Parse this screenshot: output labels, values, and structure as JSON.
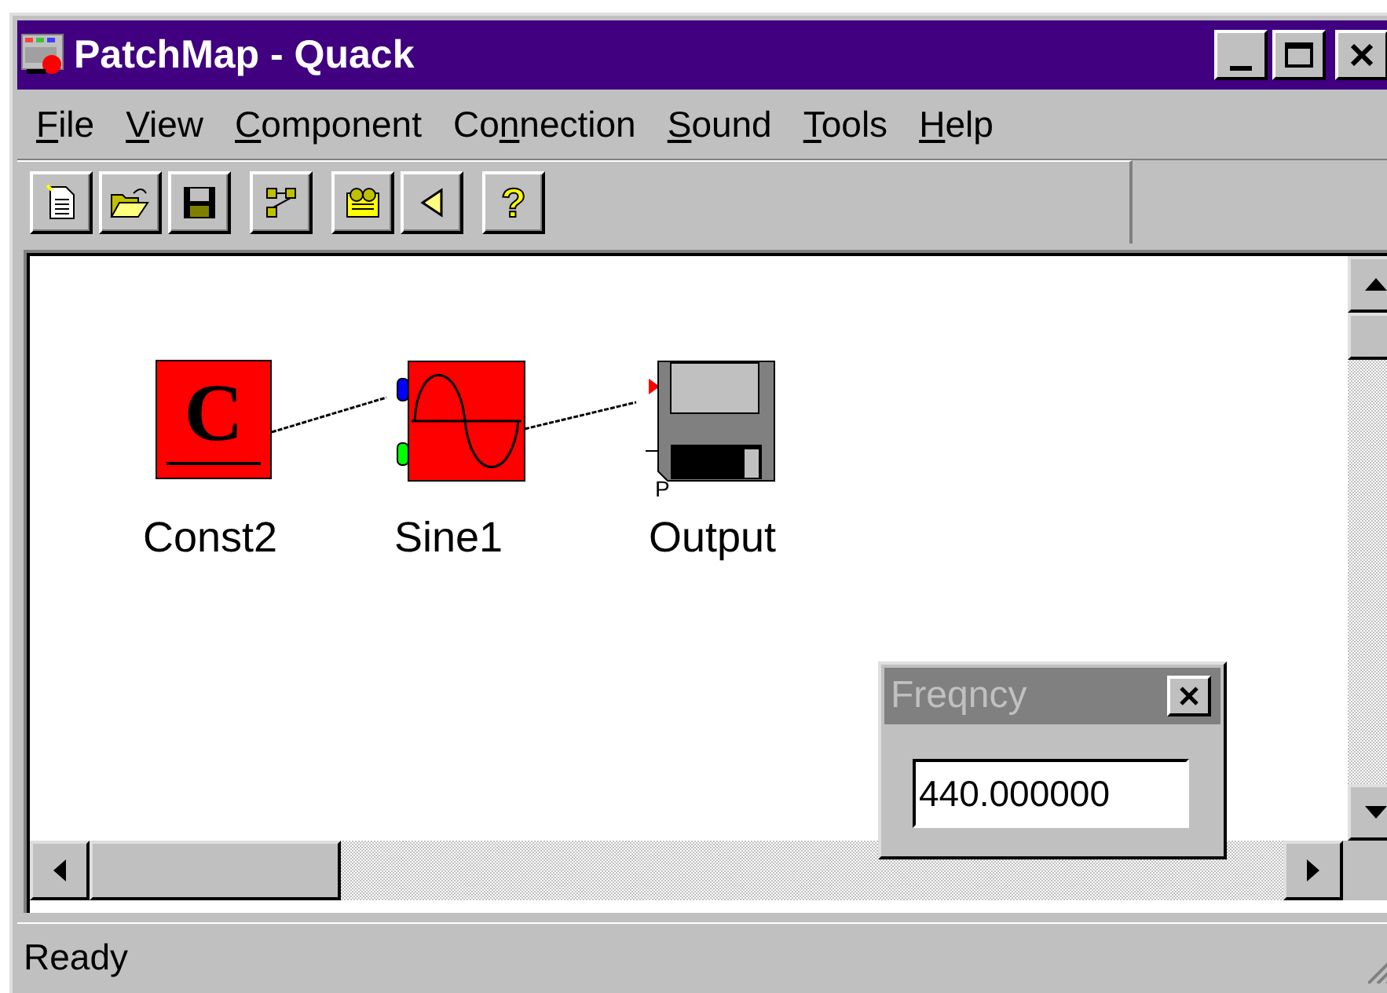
{
  "window": {
    "title": "PatchMap - Quack"
  },
  "menu": [
    {
      "key": "F",
      "post": "ile"
    },
    {
      "key": "V",
      "post": "iew"
    },
    {
      "key": "C",
      "post": "omponent"
    },
    {
      "pre": "Co",
      "key": "n",
      "post": "nection"
    },
    {
      "key": "S",
      "post": "ound"
    },
    {
      "key": "T",
      "post": "ools"
    },
    {
      "key": "H",
      "post": "elp"
    }
  ],
  "toolbar": [
    [
      {
        "kind": "new"
      },
      {
        "kind": "open"
      },
      {
        "kind": "save"
      }
    ],
    [
      {
        "kind": "diagram"
      }
    ],
    [
      {
        "kind": "tape"
      },
      {
        "kind": "speaker"
      }
    ],
    [
      {
        "kind": "help",
        "label": "?"
      }
    ]
  ],
  "canvas": {
    "nodes": [
      {
        "kind": "const",
        "symbol": "C",
        "label": "Const2"
      },
      {
        "kind": "sine",
        "label": "Sine1"
      },
      {
        "kind": "output",
        "port_label": "P",
        "label": "Output"
      }
    ]
  },
  "float_window": {
    "title": "Freqncy",
    "value": "440.000000"
  },
  "status_bar": {
    "text": "Ready"
  }
}
